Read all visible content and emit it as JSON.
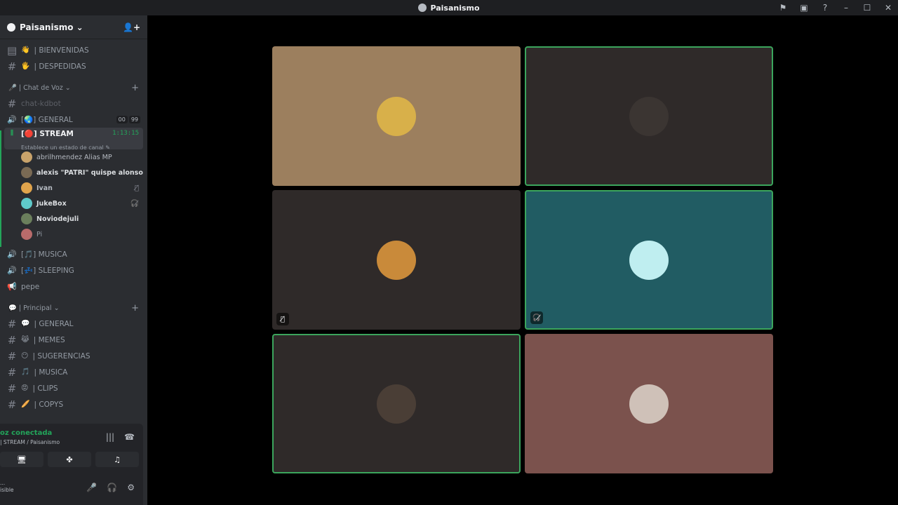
{
  "window": {
    "title": "Paisanismo"
  },
  "server": {
    "name": "Paisanismo ⌄"
  },
  "channels_top": [
    {
      "emoji": "👋",
      "name": "| BIENVENIDAS"
    },
    {
      "emoji": "🖐",
      "name": "| DESPEDIDAS"
    }
  ],
  "voice_category": {
    "label": "🎤 | Chat de Voz ⌄"
  },
  "voice_channels": {
    "kdbot": "chat-kdbot",
    "general": "[🌏] GENERAL",
    "general_badge_a": "00",
    "general_badge_b": "99",
    "stream": "[🔴] STREAM",
    "stream_timer": "1:13:15",
    "stream_status": "Establece un estado de canal ✎"
  },
  "members": [
    {
      "name": "abrilhmendez Alias MP",
      "color": "#c9a36b"
    },
    {
      "name": "alexis \"PATRI\" quispe alonso",
      "color": "#7a6a54"
    },
    {
      "name": "Ivan",
      "color": "#e0a44c"
    },
    {
      "name": "JukeBox",
      "color": "#5fc9c9"
    },
    {
      "name": "Noviodejuli",
      "color": "#6b7f5c"
    },
    {
      "name": "Pi",
      "color": "#b86b6b"
    }
  ],
  "voice_channels_more": [
    {
      "name": "[🎵] MUSICA"
    },
    {
      "name": "[💤] SLEEPING"
    },
    {
      "name": "pepe"
    }
  ],
  "text_category": {
    "label": "💬 | Principal ⌄"
  },
  "text_channels": [
    {
      "emoji": "💬",
      "name": "| GENERAL"
    },
    {
      "emoji": "😹",
      "name": "| MEMES"
    },
    {
      "emoji": "😶",
      "name": "| SUGERENCIAS"
    },
    {
      "emoji": "🎵",
      "name": "| MUSICA"
    },
    {
      "emoji": "😡",
      "name": "| CLIPS"
    },
    {
      "emoji": "🥖",
      "name": "| COPYS"
    }
  ],
  "voice_panel": {
    "status": "oz conectada",
    "channel": "| STREAM / Paisanismo",
    "user_line1": "...",
    "user_line2": "isible"
  },
  "tiles": [
    {
      "bg": "#9c7f5e",
      "speaking": false,
      "avatar_color": "#d8b04a",
      "muted": false
    },
    {
      "bg": "#2f2a29",
      "speaking": true,
      "avatar_color": "#3b3532",
      "muted": false
    },
    {
      "bg": "#2f2a29",
      "speaking": false,
      "avatar_color": "#c98a3a",
      "muted": true
    },
    {
      "bg": "#215c63",
      "speaking": true,
      "avatar_color": "#bfeef0",
      "muted": true
    },
    {
      "bg": "#2f2a29",
      "speaking": true,
      "avatar_color": "#4a3e36",
      "muted": false
    },
    {
      "bg": "#7b524d",
      "speaking": false,
      "avatar_color": "#cfc1b8",
      "muted": false
    }
  ]
}
